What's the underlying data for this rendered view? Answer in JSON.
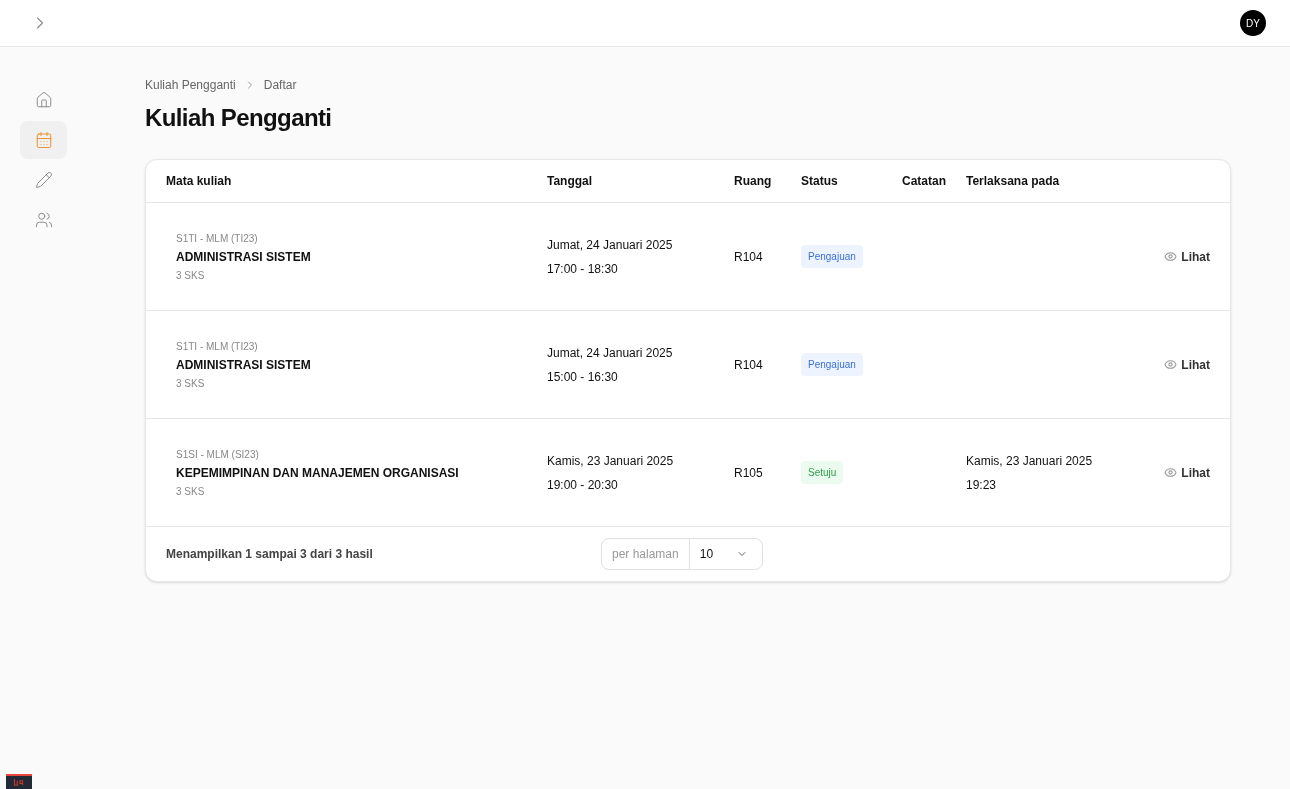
{
  "topbar": {
    "avatar": "DY"
  },
  "sidebar": {
    "items": [
      {
        "kind": "home",
        "selected": false
      },
      {
        "kind": "calendar",
        "selected": true
      },
      {
        "kind": "pencil",
        "selected": false
      },
      {
        "kind": "users",
        "selected": false
      }
    ]
  },
  "breadcrumb": [
    "Kuliah Pengganti",
    "Daftar"
  ],
  "title": "Kuliah Pengganti",
  "table": {
    "columns": [
      "Mata kuliah",
      "Tanggal",
      "Ruang",
      "Status",
      "Catatan",
      "Terlaksana pada"
    ],
    "rows": [
      {
        "class": "S1TI - MLM (TI23)",
        "course": "ADMINISTRASI SISTEM",
        "credits": "3 SKS",
        "date": "Jumat, 24 Januari 2025",
        "time": "17:00 - 18:30",
        "room": "R104",
        "status": {
          "label": "Pengajuan",
          "kind": "pending"
        },
        "action": "Lihat"
      },
      {
        "class": "S1TI - MLM (TI23)",
        "course": "ADMINISTRASI SISTEM",
        "credits": "3 SKS",
        "date": "Jumat, 24 Januari 2025",
        "time": "15:00 - 16:30",
        "room": "R104",
        "status": {
          "label": "Pengajuan",
          "kind": "pending"
        },
        "action": "Lihat"
      },
      {
        "class": "S1SI - MLM (SI23)",
        "course": "KEPEMIMPINAN DAN MANAJEMEN ORGANISASI",
        "credits": "3 SKS",
        "date": "Kamis, 23 Januari 2025",
        "time": "19:00 - 20:30",
        "room": "R105",
        "status": {
          "label": "Setuju",
          "kind": "approved"
        },
        "done_date": "Kamis, 23 Januari 2025",
        "done_time": "19:23",
        "action": "Lihat"
      }
    ]
  },
  "footer": {
    "summary": "Menampilkan 1 sampai 3 dari 3 hasil",
    "per_page_label": "per halaman",
    "per_page": "10"
  }
}
